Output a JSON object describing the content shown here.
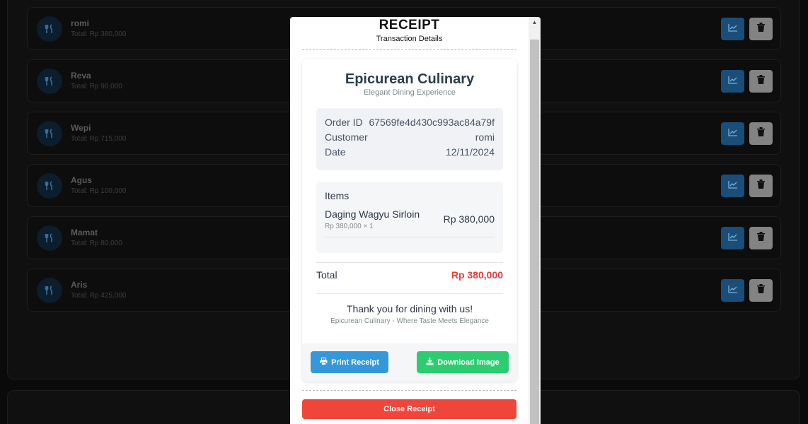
{
  "customers": [
    {
      "name": "romi",
      "total": "Total: Rp 380,000"
    },
    {
      "name": "Reva",
      "total": "Total: Rp 90,000"
    },
    {
      "name": "Wepi",
      "total": "Total: Rp 715,000"
    },
    {
      "name": "Agus",
      "total": "Total: Rp 100,000"
    },
    {
      "name": "Mamat",
      "total": "Total: Rp 80,000"
    },
    {
      "name": "Aris",
      "total": "Total: Rp 425,000"
    }
  ],
  "modal": {
    "title": "RECEIPT",
    "subtitle": "Transaction Details",
    "restaurant": "Epicurean Culinary",
    "tagline": "Elegant Dining Experience",
    "order_id_label": "Order ID",
    "order_id": "67569fe4d430c993ac84a79f",
    "customer_label": "Customer",
    "customer": "romi",
    "date_label": "Date",
    "date": "12/11/2024",
    "items_heading": "Items",
    "items": [
      {
        "name": "Daging Wagyu Sirloin",
        "detail": "Rp 380,000 × 1",
        "price": "Rp 380,000"
      }
    ],
    "total_label": "Total",
    "total": "Rp 380,000",
    "thanks": "Thank you for dining with us!",
    "footer": "Epicurean Culinary - Where Taste Meets Elegance",
    "print_label": "Print Receipt",
    "download_label": "Download Image",
    "close_label": "Close Receipt"
  },
  "colors": {
    "chart_button": "#1a4e78",
    "delete_button": "#838383",
    "print_button": "#3498db",
    "download_button": "#2ecc71",
    "close_button": "#f0453a",
    "total_value": "#e53e3e"
  },
  "icons": {
    "row_icon": "utensils-icon",
    "chart": "chart-line-icon",
    "delete": "trash-icon",
    "print": "printer-icon",
    "download": "download-icon",
    "scroll_up": "chevron-up-icon"
  }
}
